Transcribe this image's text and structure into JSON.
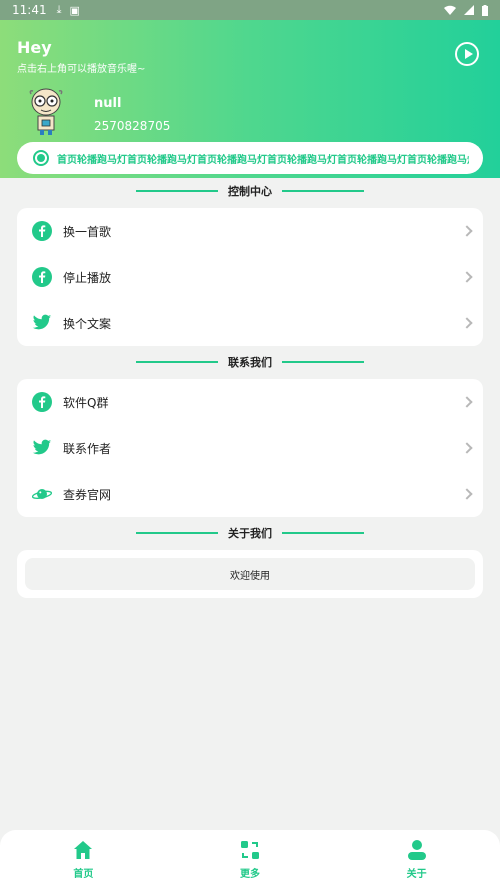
{
  "status_bar": {
    "time": "11:41"
  },
  "header": {
    "greeting": "Hey",
    "subtitle": "点击右上角可以播放音乐喔~",
    "user_name": "null",
    "user_id": "2570828705",
    "accent_color": "#22c98a"
  },
  "marquee": {
    "text": "首页轮播跑马灯首页轮播跑马灯首页轮播跑马灯首页轮播跑马灯首页轮播跑马灯首页轮播跑马灯首页轮播跑马"
  },
  "sections": {
    "control": {
      "title": "控制中心",
      "items": [
        {
          "label": "换一首歌",
          "icon": "facebook-icon"
        },
        {
          "label": "停止播放",
          "icon": "facebook-icon"
        },
        {
          "label": "换个文案",
          "icon": "twitter-icon"
        }
      ]
    },
    "contact": {
      "title": "联系我们",
      "items": [
        {
          "label": "软件Q群",
          "icon": "facebook-icon"
        },
        {
          "label": "联系作者",
          "icon": "twitter-icon"
        },
        {
          "label": "查券官网",
          "icon": "planet-icon"
        }
      ]
    },
    "about": {
      "title": "关于我们",
      "welcome": "欢迎使用"
    }
  },
  "tabbar": {
    "items": [
      {
        "label": "首页",
        "icon": "home-icon"
      },
      {
        "label": "更多",
        "icon": "more-icon"
      },
      {
        "label": "关于",
        "icon": "user-icon"
      }
    ]
  }
}
